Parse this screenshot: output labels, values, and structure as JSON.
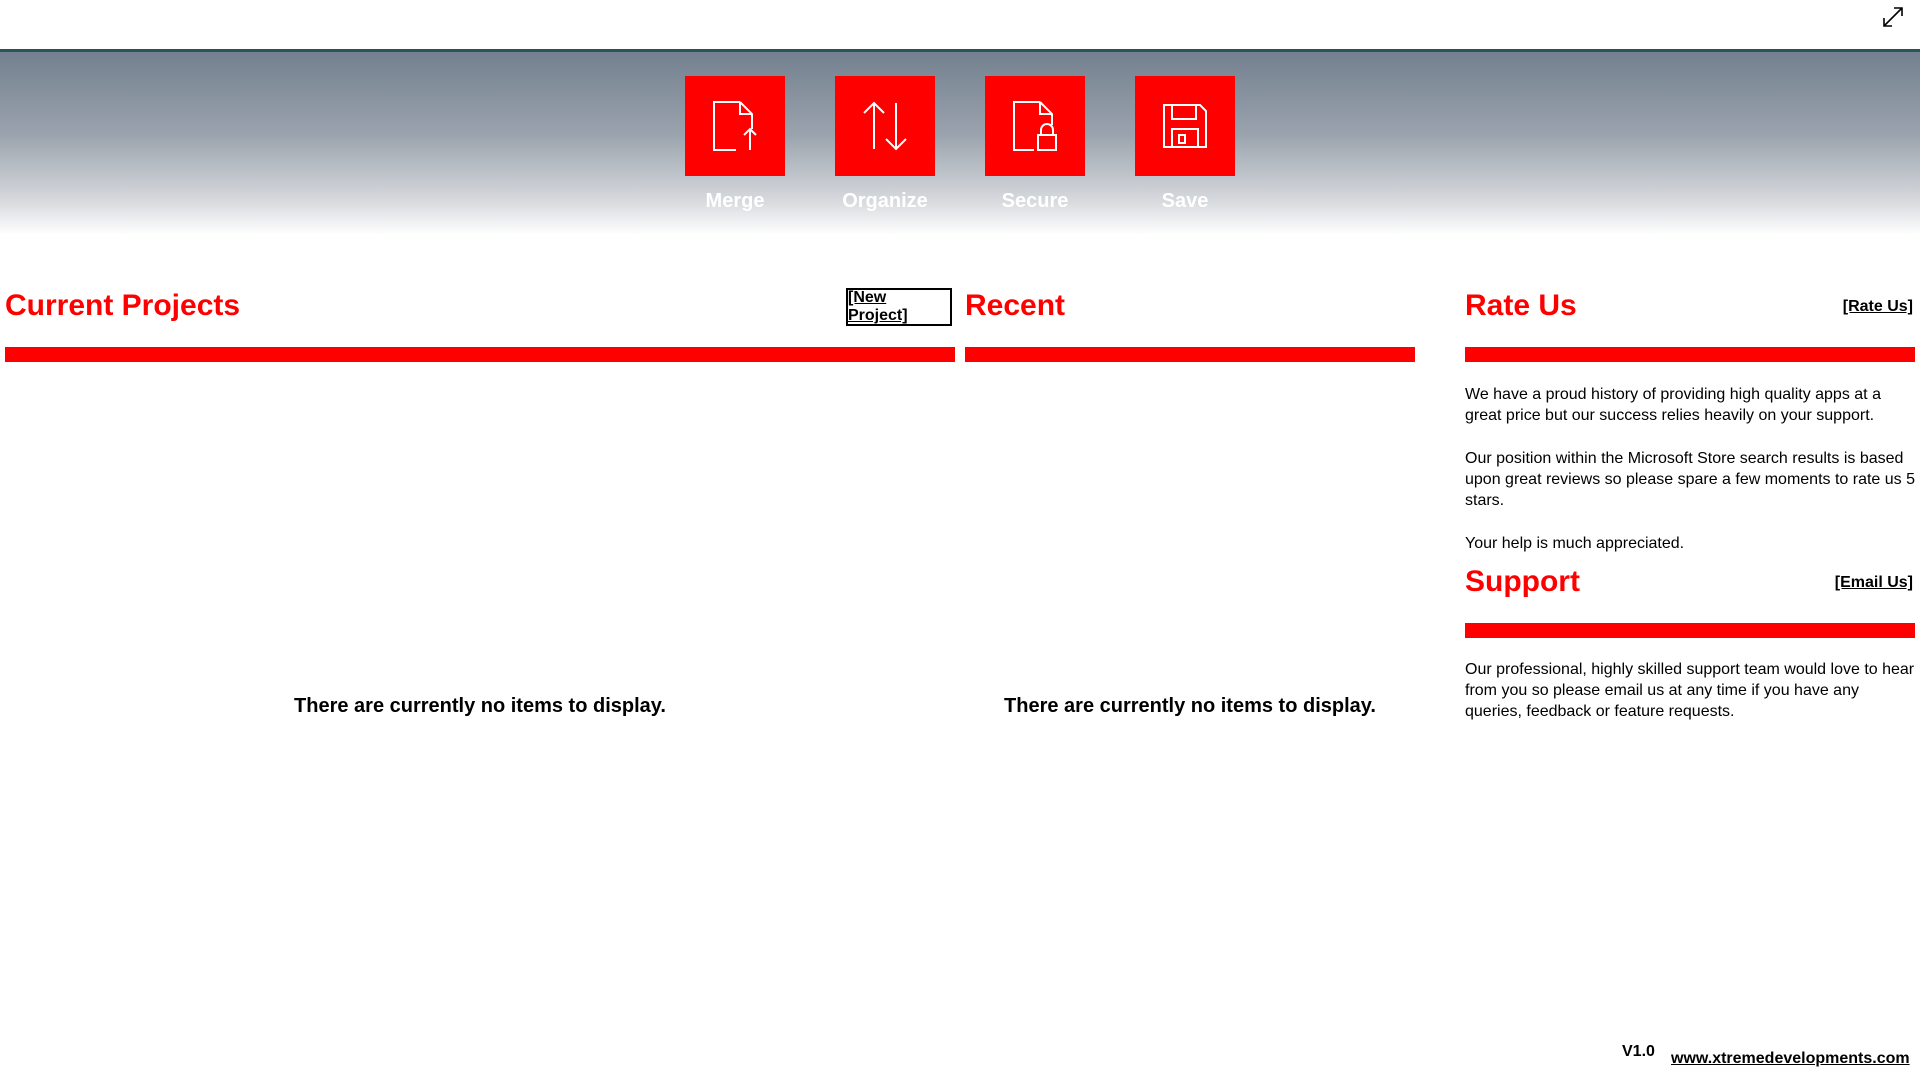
{
  "toolbar": {
    "items": [
      {
        "label": "Merge",
        "icon": "merge-document-icon"
      },
      {
        "label": "Organize",
        "icon": "sort-arrows-icon"
      },
      {
        "label": "Secure",
        "icon": "lock-document-icon"
      },
      {
        "label": "Save",
        "icon": "floppy-disk-icon"
      }
    ]
  },
  "current_projects": {
    "title": "Current Projects",
    "new_project_label": "[New Project]",
    "empty_text": "There are currently no items to display."
  },
  "recent": {
    "title": "Recent",
    "empty_text": "There are currently no items to display."
  },
  "rate_us": {
    "title": "Rate Us",
    "link_label": "[Rate Us]",
    "paragraphs": [
      "We have a proud history of providing high quality apps at a great price but our success relies heavily on your support.",
      "Our position within the Microsoft Store search results is based upon great reviews so please spare a few moments to rate us 5 stars.",
      "Your help is much appreciated."
    ]
  },
  "support": {
    "title": "Support",
    "link_label": "[Email Us]",
    "paragraph": "Our professional, highly skilled support team would love to hear from you so please email us at any time if you have any queries, feedback or feature requests."
  },
  "footer": {
    "version": "V1.0",
    "website": "www.xtremedevelopments.com"
  },
  "colors": {
    "accent": "#ff0000",
    "banner_border": "#2b5555"
  }
}
